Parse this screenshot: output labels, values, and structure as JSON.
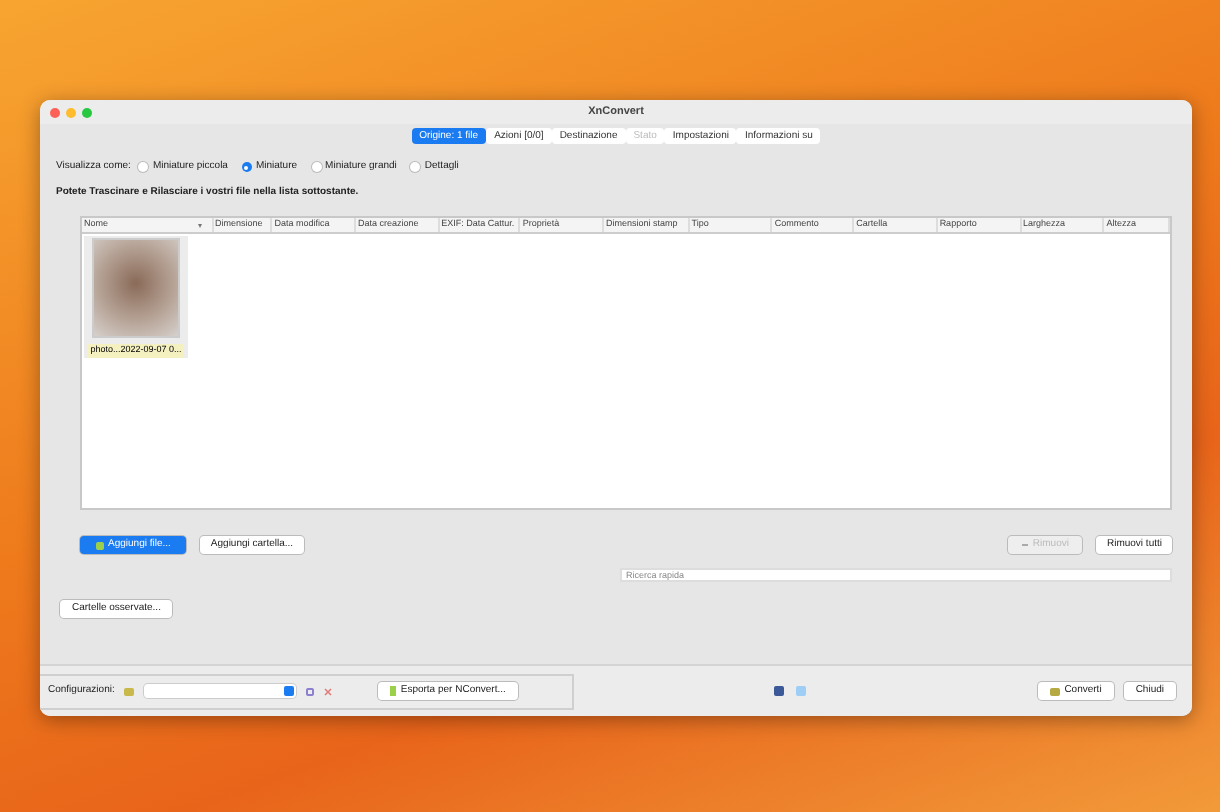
{
  "window": {
    "title": "XnConvert"
  },
  "tabs": [
    {
      "label": "Origine: 1 file",
      "selected": true,
      "disabled": false
    },
    {
      "label": "Azioni [0/0]",
      "selected": false,
      "disabled": false
    },
    {
      "label": "Destinazione",
      "selected": false,
      "disabled": false
    },
    {
      "label": "Stato",
      "selected": false,
      "disabled": true
    },
    {
      "label": "Impostazioni",
      "selected": false,
      "disabled": false
    },
    {
      "label": "Informazioni su",
      "selected": false,
      "disabled": false
    }
  ],
  "view_as": {
    "label": "Visualizza come:",
    "options": [
      {
        "label": "Miniature piccola",
        "selected": false
      },
      {
        "label": "Miniature",
        "selected": true
      },
      {
        "label": "Miniature grandi",
        "selected": false
      },
      {
        "label": "Dettagli",
        "selected": false
      }
    ]
  },
  "hint": "Potete Trascinare e Rilasciare i vostri file nella lista sottostante.",
  "file_list": {
    "columns": [
      "Nome",
      "Dimensione",
      "Data modifica",
      "Data creazione",
      "EXIF: Data Cattur.",
      "Proprietà",
      "Dimensioni stamp",
      "Tipo",
      "Commento",
      "Cartella",
      "Rapporto",
      "Larghezza",
      "Altezza"
    ],
    "items": [
      {
        "caption": "photo...2022-09-07 0...",
        "selected": true
      }
    ]
  },
  "buttons_left": [
    {
      "label": "Aggiungi file...",
      "primary": true
    },
    {
      "label": "Aggiungi cartella...",
      "primary": false
    }
  ],
  "buttons_right": [
    {
      "label": "Rimuovi",
      "disabled": true
    },
    {
      "label": "Rimuovi tutti",
      "disabled": false
    }
  ],
  "search": {
    "placeholder": "Ricerca rapida"
  },
  "watched_button": "Cartelle osservate...",
  "config": {
    "label": "Configurazioni:",
    "export_button": "Esporta per NConvert..."
  },
  "footer_buttons": [
    "Converti",
    "Chiudi"
  ]
}
